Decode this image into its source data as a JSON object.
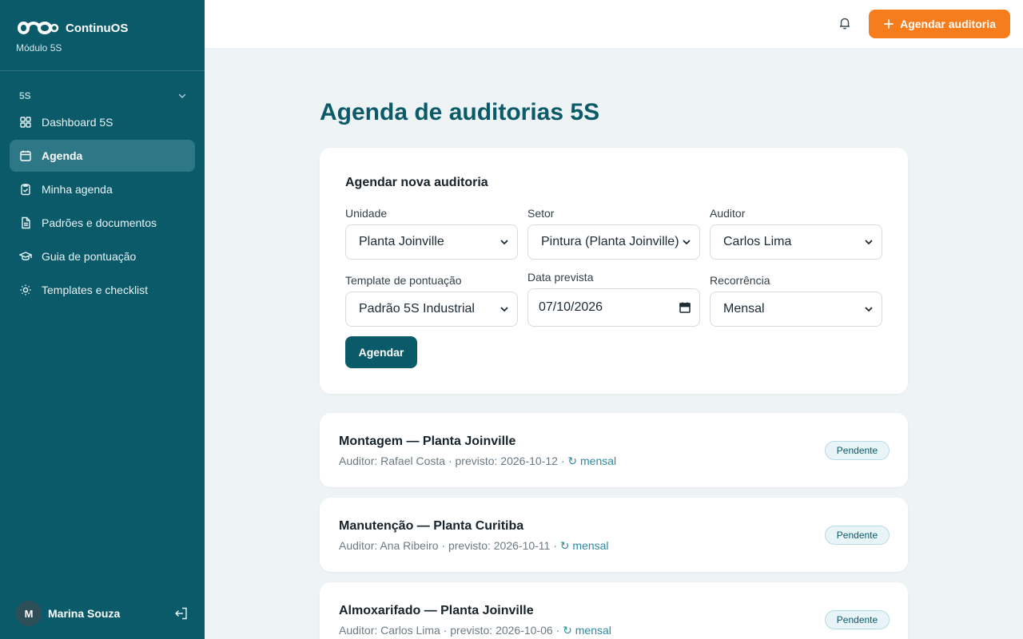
{
  "app": {
    "name": "ContinuOS",
    "module": "Módulo 5S"
  },
  "sidebar": {
    "group_label": "5S",
    "items": [
      {
        "label": "Dashboard 5S",
        "icon": "dashboard-icon",
        "active": false
      },
      {
        "label": "Agenda",
        "icon": "calendar-icon",
        "active": true
      },
      {
        "label": "Minha agenda",
        "icon": "clipboard-check-icon",
        "active": false
      },
      {
        "label": "Padrões e documentos",
        "icon": "document-icon",
        "active": false
      },
      {
        "label": "Guia de pontuação",
        "icon": "graduation-cap-icon",
        "active": false
      },
      {
        "label": "Templates e checklist",
        "icon": "sun-icon",
        "active": false
      }
    ],
    "user": {
      "initial": "M",
      "name": "Marina Souza"
    }
  },
  "topbar": {
    "cta_label": "Agendar auditoria"
  },
  "page": {
    "title": "Agenda de auditorias 5S"
  },
  "form": {
    "title": "Agendar nova auditoria",
    "unidade": {
      "label": "Unidade",
      "value": "Planta Joinville"
    },
    "setor": {
      "label": "Setor",
      "value": "Pintura (Planta Joinville)"
    },
    "auditor": {
      "label": "Auditor",
      "value": "Carlos Lima"
    },
    "template": {
      "label": "Template de pontuação",
      "value": "Padrão 5S Industrial"
    },
    "data": {
      "label": "Data prevista",
      "value": "07/10/2026"
    },
    "recorrencia": {
      "label": "Recorrência",
      "value": "Mensal"
    },
    "submit_label": "Agendar"
  },
  "audits": [
    {
      "title": "Montagem — Planta Joinville",
      "meta": "Auditor: Rafael Costa · previsto: 2026-10-12 · ",
      "recurrence": "↻ mensal",
      "status": "Pendente"
    },
    {
      "title": "Manutenção — Planta Curitiba",
      "meta": "Auditor: Ana Ribeiro · previsto: 2026-10-11 · ",
      "recurrence": "↻ mensal",
      "status": "Pendente"
    },
    {
      "title": "Almoxarifado — Planta Joinville",
      "meta": "Auditor: Carlos Lima · previsto: 2026-10-06 · ",
      "recurrence": "↻ mensal",
      "status": "Pendente"
    }
  ],
  "colors": {
    "sidebar": "#0b5a6a",
    "accent": "#f77c1c",
    "title": "#0b5a6a",
    "active_item": "#2d7786"
  }
}
